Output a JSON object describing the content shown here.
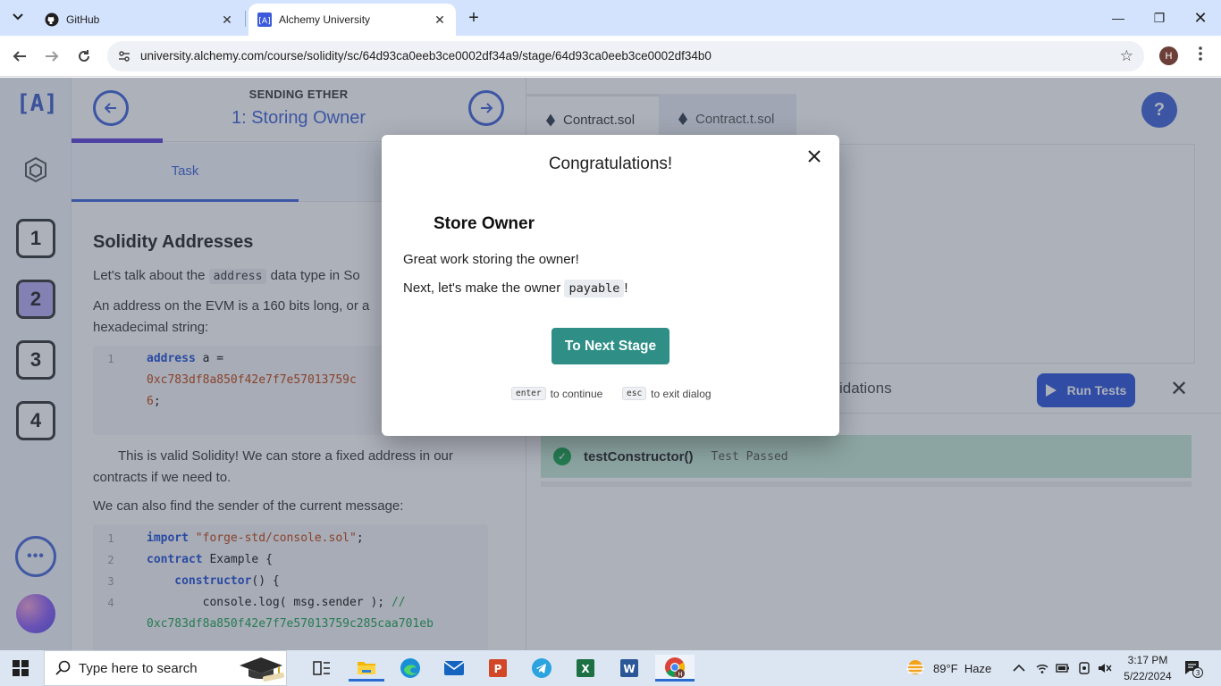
{
  "browser": {
    "tabs": [
      {
        "title": "GitHub",
        "active": false
      },
      {
        "title": "Alchemy University",
        "active": true
      }
    ],
    "url": "university.alchemy.com/course/solidity/sc/64d93ca0eeb3ce0002df34a9/stage/64d93ca0eeb3ce0002df34b0",
    "profile_initial": "H"
  },
  "app": {
    "logo_text": "[A]",
    "stage_category": "SENDING ETHER",
    "stage_name": "1: Storing Owner",
    "progress_fraction": 0.2,
    "steps": [
      "1",
      "2",
      "3",
      "4"
    ],
    "current_step": "2",
    "more_label": "•••",
    "task_tab": "Task",
    "content": {
      "heading": "Solidity Addresses",
      "p1_pre": "Let's talk about the",
      "p1_code": "address",
      "p1_post": "data type in So",
      "p2_line1": "An address on the EVM is a 160 bits long, or a",
      "p2_line2": "hexadecimal string:",
      "code1": [
        {
          "n": "1",
          "kw": "address",
          "rest": " a ="
        },
        {
          "n": "",
          "hex": "0xc783df8a850f42e7f7e57013759c",
          "rest": ""
        },
        {
          "n": "",
          "hex": "6",
          "rest": ";"
        }
      ],
      "p3_line1": "This is valid Solidity! We can store a fixed address in our",
      "p3_line2": "contracts if we need to.",
      "p4": "We can also find the sender of the current message:",
      "code2": [
        {
          "n": "1",
          "kw": "import",
          "str": " \"forge-std/console.sol\"",
          "rest": ";"
        },
        {
          "n": "2",
          "kw": "contract",
          "rest": " Example {"
        },
        {
          "n": "3",
          "kw": "    constructor",
          "rest": "() {"
        },
        {
          "n": "4",
          "rest": "        console.log( msg.sender ); ",
          "cmt": "//"
        },
        {
          "n": "",
          "cmt": "0xc783df8a850f42e7f7e57013759c285caa701eb"
        }
      ]
    },
    "files": [
      "Contract.sol",
      "Contract.t.sol"
    ],
    "help_label": "?",
    "validations_label": "idations",
    "run_tests_label": "Run Tests",
    "test": {
      "name": "testConstructor()",
      "status": "Test Passed"
    }
  },
  "modal": {
    "title": "Congratulations!",
    "subtitle": "Store Owner",
    "line1": "Great work storing the owner!",
    "line2_pre": "Next, let's make the owner",
    "line2_code": "payable",
    "line2_post": "!",
    "button": "To Next Stage",
    "hint1_key": "enter",
    "hint1_text": "to continue",
    "hint2_key": "esc",
    "hint2_text": "to exit dialog"
  },
  "taskbar": {
    "search_placeholder": "Type here to search",
    "weather": "89°F  Haze",
    "time": "3:17 PM",
    "date": "5/22/2024",
    "notification_count": "3"
  }
}
